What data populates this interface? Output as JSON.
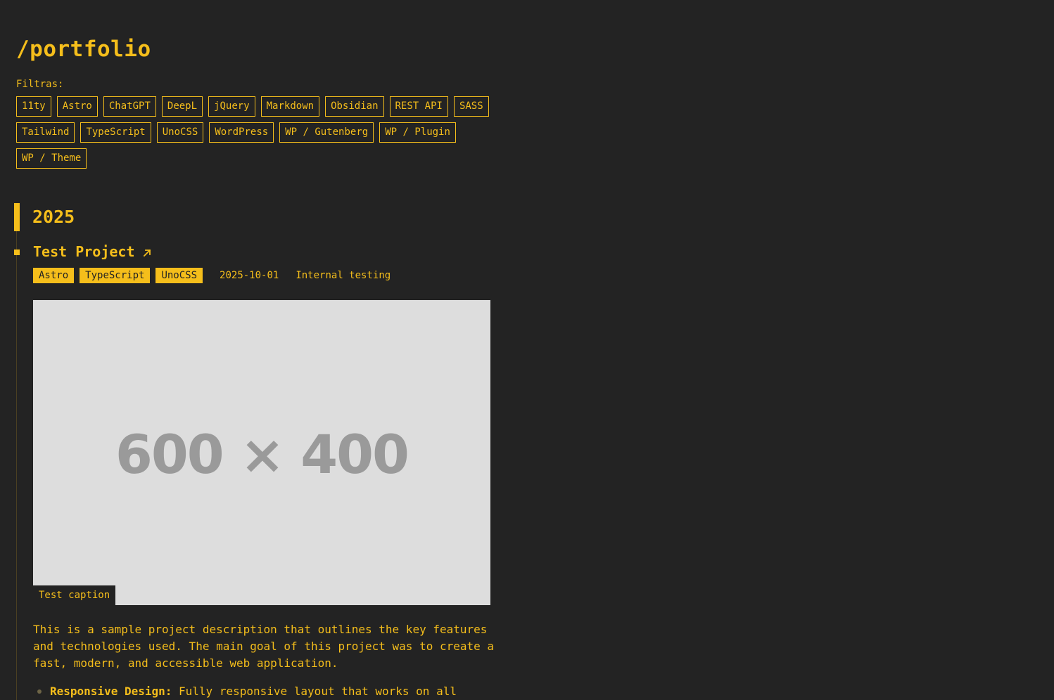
{
  "page": {
    "title": "/portfolio",
    "filters_label": "Filtras:"
  },
  "filters": [
    "11ty",
    "Astro",
    "ChatGPT",
    "DeepL",
    "jQuery",
    "Markdown",
    "Obsidian",
    "REST API",
    "SASS",
    "Tailwind",
    "TypeScript",
    "UnoCSS",
    "WordPress",
    "WP / Gutenberg",
    "WP / Plugin",
    "WP / Theme"
  ],
  "timeline": {
    "year": "2025",
    "project": {
      "title": "Test Project",
      "link_icon": "arrow-up-right-icon",
      "tags": [
        "Astro",
        "TypeScript",
        "UnoCSS"
      ],
      "date": "2025-10-01",
      "note": "Internal testing",
      "image_placeholder": "600 × 400",
      "caption": "Test caption",
      "description": "This is a sample project description that outlines the key features and technologies used. The main goal of this project was to create a fast, modern, and accessible web application.",
      "features": [
        {
          "title": "Responsive Design:",
          "text": " Fully responsive layout that works on all"
        }
      ]
    }
  },
  "colors": {
    "background": "#232323",
    "accent": "#f5be1b",
    "image_placeholder_bg": "#dddddd"
  }
}
